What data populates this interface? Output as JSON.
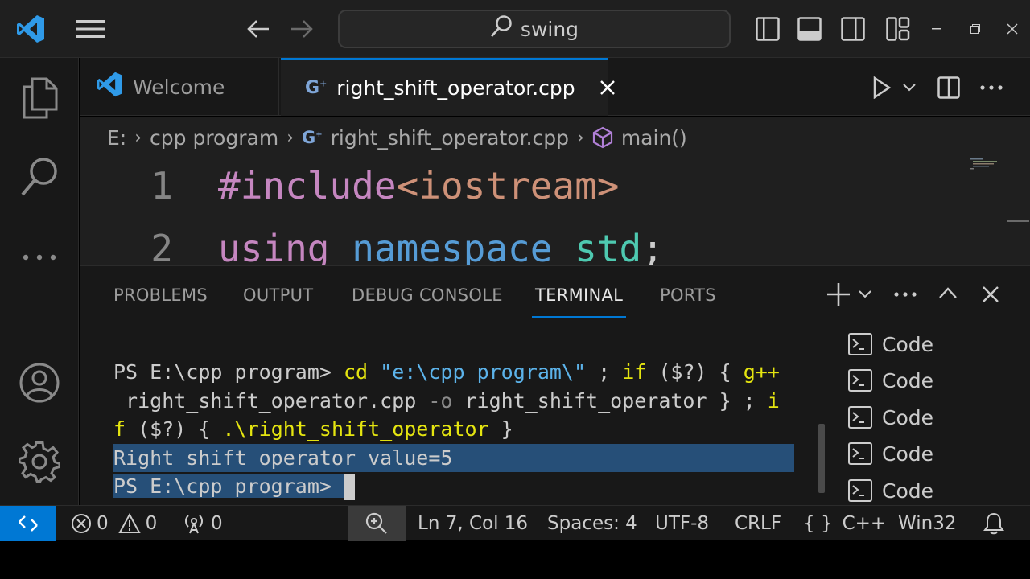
{
  "titlebar": {
    "search_text": "swing",
    "icons": [
      "vscode-logo-icon",
      "menu-icon",
      "back-arrow-icon",
      "forward-arrow-icon",
      "search-icon",
      "toggle-primary-sidebar-icon",
      "toggle-panel-icon",
      "toggle-secondary-sidebar-icon",
      "customize-layout-icon",
      "minimize-icon",
      "restore-icon",
      "close-icon"
    ]
  },
  "activitybar": {
    "icons": [
      "explorer-icon",
      "search-icon",
      "more-icon",
      "accounts-icon",
      "manage-gear-icon"
    ]
  },
  "tabs": [
    {
      "label": "Welcome",
      "icon": "vscode-logo-icon",
      "active": false
    },
    {
      "label": "right_shift_operator.cpp",
      "icon": "cpp-file-icon",
      "active": true
    }
  ],
  "breadcrumb": {
    "drive": "E:",
    "folder": "cpp program",
    "file": "right_shift_operator.cpp",
    "symbol": "main()"
  },
  "editor": {
    "lines": [
      {
        "number": "1",
        "tokens": [
          {
            "t": "#include",
            "c": "pink"
          },
          {
            "t": "<iostream>",
            "c": "orange"
          }
        ]
      },
      {
        "number": "2",
        "tokens": [
          {
            "t": "using",
            "c": "pink"
          },
          {
            "t": " ",
            "c": "punc"
          },
          {
            "t": "namespace",
            "c": "blue"
          },
          {
            "t": " ",
            "c": "punc"
          },
          {
            "t": "std",
            "c": "teal"
          },
          {
            "t": ";",
            "c": "punc"
          }
        ]
      }
    ]
  },
  "panel": {
    "tabs": [
      "PROBLEMS",
      "OUTPUT",
      "DEBUG CONSOLE",
      "TERMINAL",
      "PORTS"
    ],
    "active_tab": "TERMINAL",
    "terminal": {
      "prompt": "PS E:\\cpp program>",
      "cmd_cd": "cd",
      "cd_path": "\"e:\\cpp program\\\"",
      "sep1": " ; ",
      "if1": "if",
      "cond1": " ($?) { ",
      "gpp": "g++",
      "line2_file": " right_shift_operator.cpp ",
      "flag": "-o",
      "line2_out": " right_shift_operator } ; ",
      "line2_i": "i",
      "line3_f": "f",
      "cond2": " ($?) { ",
      "run": ".\\right_shift_operator",
      "close": " }",
      "output": "Right shift operator value=5",
      "final_prompt": "PS E:\\cpp program> "
    },
    "terminal_instances": [
      "Code",
      "Code",
      "Code",
      "Code",
      "Code"
    ]
  },
  "statusbar": {
    "errors": "0",
    "warnings": "0",
    "ports": "0",
    "cursor_position": "Ln 7, Col 16",
    "spaces": "Spaces: 4",
    "encoding": "UTF-8",
    "eol": "CRLF",
    "language": "C++",
    "language_icon": "{ }",
    "platform": "Win32"
  },
  "colors": {
    "accent": "#0078d4",
    "editor_bg": "#1f1f1f",
    "chrome_bg": "#181818"
  }
}
